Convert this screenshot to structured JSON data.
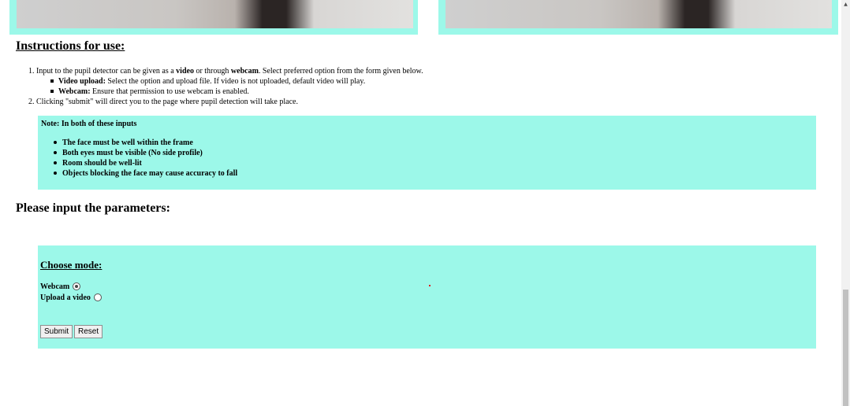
{
  "instructions": {
    "title": "Instructions for use:",
    "step1": {
      "num": "1.",
      "text_a": "Input to the pupil detector can be given as a ",
      "video_bold": "video",
      "text_b": " or through ",
      "webcam_bold": "webcam",
      "text_c": ". Select preferred option from the form given below."
    },
    "sub1": {
      "label": "Video upload:",
      "text": " Select the option and upload file. If video is not uploaded, default video will play."
    },
    "sub2": {
      "label": "Webcam:",
      "text": " Ensure that permission to use webcam is enabled."
    },
    "step2": {
      "num": "2.",
      "text": "Clicking \"submit\" will direct you to the page where pupil detection will take place."
    }
  },
  "note": {
    "title": "Note: In both of these inputs",
    "items": [
      "The face must be well within the frame",
      "Both eyes must be visible (No side profile)",
      "Room should be well-lit",
      "Objects blocking the face may cause accuracy to fall"
    ]
  },
  "params": {
    "title": "Please input the parameters:",
    "mode_label": "Choose mode:",
    "options": [
      {
        "label": "Webcam",
        "selected": true
      },
      {
        "label": "Upload a video",
        "selected": false
      }
    ],
    "submit_label": "Submit",
    "reset_label": "Reset"
  },
  "colors": {
    "panel": "#9cf8e9",
    "accent_dot": "#e02020"
  }
}
